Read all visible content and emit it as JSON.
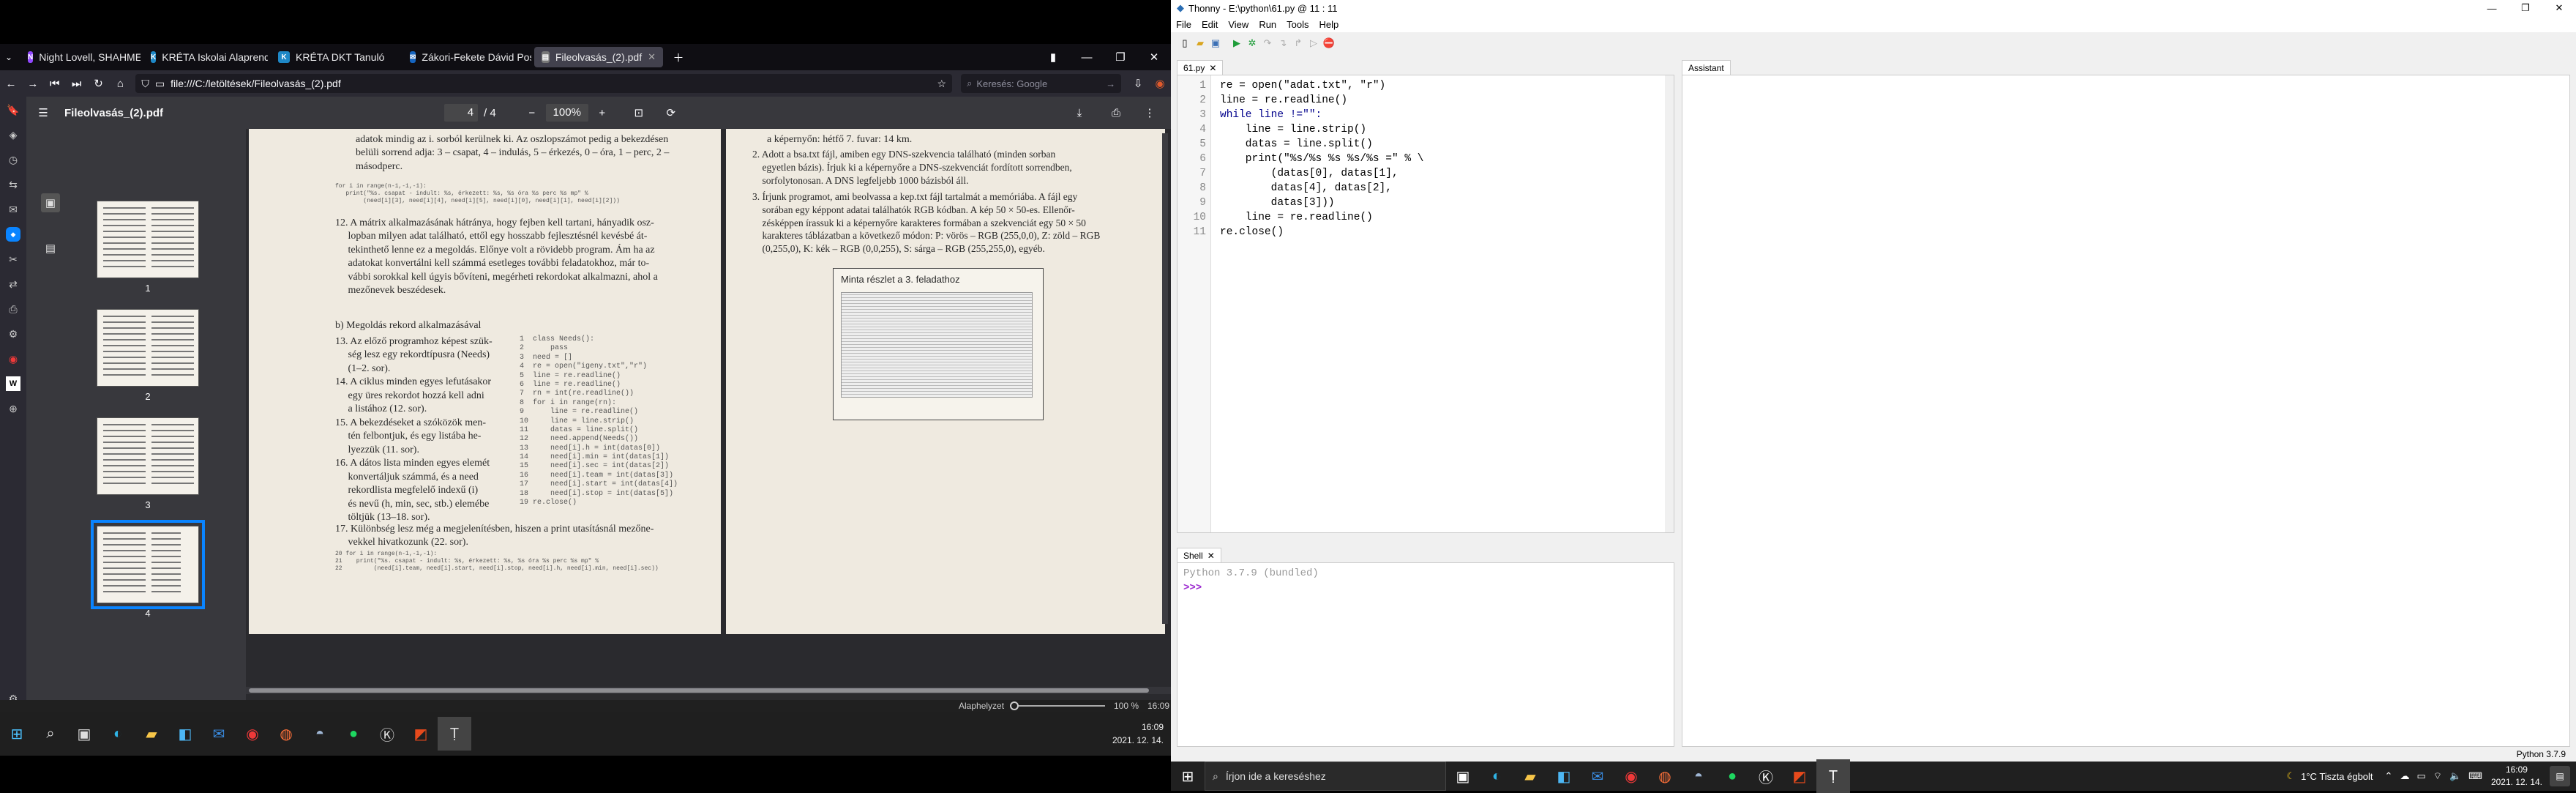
{
  "browser": {
    "tabs": [
      {
        "label": "Night Lovell, SHAHMEN, A",
        "fav": "N",
        "color": "#9147ff"
      },
      {
        "label": "KRÉTA Iskolai Alaprendszer",
        "fav": "K",
        "color": "#1e88c7"
      },
      {
        "label": "KRÉTA DKT Tanuló",
        "fav": "K",
        "color": "#1e88c7"
      },
      {
        "label": "Zákori-Fekete Dávid Postaláda",
        "fav": "✉",
        "color": "#1565c0"
      },
      {
        "label": "Fileolvasás_(2).pdf",
        "fav": "▤",
        "color": "#777"
      }
    ],
    "url": "file:///C:/letöltések/Fileolvasás_(2).pdf",
    "search_placeholder": "Keresés: Google",
    "pdf": {
      "filename": "Fileolvasás_(2).pdf",
      "page_current": "4",
      "page_total": "/ 4",
      "zoom": "100%",
      "thumb_numbers": [
        "1",
        "2",
        "3",
        "4"
      ]
    },
    "left_page": {
      "intro": "adatok mindig az i. sorból kerülnek ki. Az oszlopszámot pedig a bekezdésen\nbelüli sorrend adja: 3 – csapat, 4 – indulás, 5 – érkezés, 0 – óra, 1 – perc, 2 –\nmásodperc.",
      "code1": "for i in range(n-1,-1,-1):\n   print(\"%s. csapat - indult: %s, érkezett: %s, %s óra %s perc %s mp\" % \n        (need[i][3], need[i][4], need[i][5], need[i][0], need[i][1], need[i][2]))",
      "p12": "12. A mátrix alkalmazásának hátránya, hogy fejben kell tartani, hányadik osz-\n     lopban milyen adat található, ettől egy hosszabb fejlesztésnél kevésbé át-\n     tekinthető lenne ez a megoldás. Előnye volt a rövidebb program. Ám ha az\n     adatokat konvertálni kell számmá esetleges további feladatokhoz, már to-\n     vábbi sorokkal kell úgyis bővíteni, megérheti rekordokat alkalmazni, ahol a\n     mezőnevek beszédesek.",
      "heading_b": "b) Megoldás rekord alkalmazásával",
      "p13_16": "13. Az előző programhoz képest szük-\n     ség lesz egy rekordtípusra (Needs)\n     (1–2. sor).\n14. A ciklus minden egyes lefutásakor\n     egy üres rekordot hozzá kell adni\n     a listához (12. sor).\n15. A bekezdéseket a szóközök men-\n     tén felbontjuk, és egy listába he-\n     lyezzük (11. sor).\n16. A dátos lista minden egyes elemét\n     konvertáljuk számmá, és a need\n     rekordlista megfelelő indexű (i)\n     és nevű (h, min, sec, stb.) elemébe\n     töltjük (13–18. sor).",
      "code2": "1  class Needs():\n2      pass\n3  need = []\n4  re = open(\"igeny.txt\",\"r\")\n5  line = re.readline()\n6  line = re.readline()\n7  rn = int(re.readline())\n8  for i in range(rn):\n9      line = re.readline()\n10     line = line.strip()\n11     datas = line.split()\n12     need.append(Needs())\n13     need[i].h = int(datas[0])\n14     need[i].min = int(datas[1])\n15     need[i].sec = int(datas[2])\n16     need[i].team = int(datas[3])\n17     need[i].start = int(datas[4])\n18     need[i].stop = int(datas[5])\n19 re.close()",
      "p17": "17. Különbség lesz még a megjelenítésben, hiszen a print utasításnál mezőne-\n     vekkel hivatkozunk (22. sor).",
      "code3": "20 for i in range(n-1,-1,-1):\n21    print(\"%s. csapat - indult: %s, érkezett: %s, %s óra %s perc %s mp\" % \n22         (need[i].team, need[i].start, need[i].stop, need[i].h, need[i].min, need[i].sec))"
    },
    "right_page": {
      "p_top": "a képernyőn: hétfő 7. fuvar: 14 km.",
      "p2": "2. Adott a bsa.txt fájl, amiben egy DNS-szekvencia található (minden sorban\n    egyetlen bázis). Írjuk ki a képernyőre a DNS-szekvenciát fordított sorrendben,\n    sorfolytonosan. A DNS legfeljebb 1000 bázisból áll.",
      "p3": "3. Írjunk programot, ami beolvassa a kep.txt fájl tartalmát a memóriába. A fájl egy\n    sorában egy képpont adatai találhatók RGB kódban. A kép 50 × 50-es. Ellenőr-\n    zésképpen írassuk ki a képernyőre karakteres formában a szekvenciát egy 50 × 50\n    karakteres táblázatban a következő módon: P: vörös – RGB (255,0,0), Z: zöld – RGB\n    (0,255,0), K: kék – RGB (0,0,255), S: sárga – RGB (255,255,0), egyéb.",
      "figure_title": "Minta részlet a 3. feladathoz"
    },
    "statusbar": {
      "zoom_label": "Alaphelyzet",
      "zoom_value": "100 %",
      "time": "16:09"
    }
  },
  "taskbar_left": {
    "time": "16:09",
    "date": "2021. 12. 14."
  },
  "thonny": {
    "title": "Thonny  -  E:\\python\\61.py  @  11 : 11",
    "menu": [
      "File",
      "Edit",
      "View",
      "Run",
      "Tools",
      "Help"
    ],
    "editor_tab": "61.py",
    "assistant_tab": "Assistant",
    "shell_tab": "Shell",
    "line_numbers": [
      "1",
      "2",
      "3",
      "4",
      "5",
      "6",
      "7",
      "8",
      "9",
      "10",
      "11"
    ],
    "code": [
      "re = open(\"adat.txt\", \"r\")",
      "line = re.readline()",
      "while line !=\"\":",
      "    line = line.strip()",
      "    datas = line.split()",
      "    print(\"%s/%s %s %s/%s =\" % \\",
      "        (datas[0], datas[1],",
      "        datas[4], datas[2],",
      "        datas[3]))",
      "    line = re.readline()",
      "re.close()"
    ],
    "shell_banner": "Python 3.7.9 (bundled)",
    "shell_prompt": ">>>",
    "status": "Python 3.7.9"
  },
  "taskbar_right": {
    "search_placeholder": "Írjon ide a kereséshez",
    "weather": "1°C  Tiszta égbolt",
    "time": "16:09",
    "date": "2021. 12. 14."
  }
}
